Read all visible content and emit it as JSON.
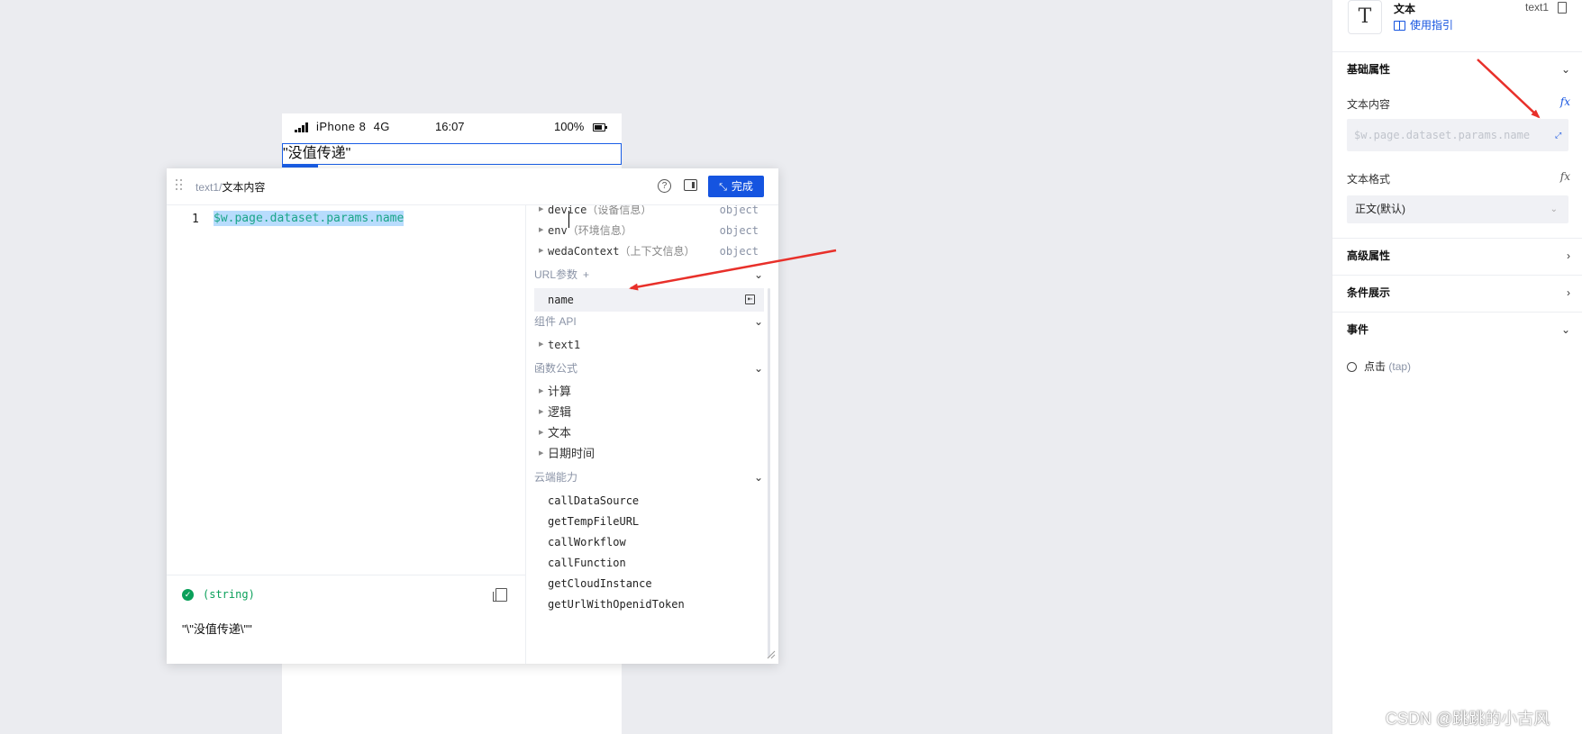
{
  "phone": {
    "device": "iPhone 8",
    "network": "4G",
    "time": "16:07",
    "battery": "100%",
    "text_component_value": "\"没值传递\""
  },
  "editor": {
    "breadcrumb_component": "text1",
    "breadcrumb_sep": "/",
    "breadcrumb_prop": "文本内容",
    "help_icon": "?",
    "done_label": "完成",
    "code_line_number": "1",
    "code": "$w.page.dataset.params.name",
    "result_type": "(string)",
    "result_value": "\"\\\"没值传递\\\"\"",
    "side": {
      "variables": [
        {
          "name": "device",
          "desc": "（设备信息）",
          "type": "object"
        },
        {
          "name": "env",
          "desc": "（环境信息）",
          "type": "object"
        },
        {
          "name": "wedaContext",
          "desc": "（上下文信息）",
          "type": "object"
        }
      ],
      "url_params_title": "URL参数",
      "url_params_add": "+",
      "url_params": [
        "name"
      ],
      "component_api_title": "组件 API",
      "component_api": [
        "text1"
      ],
      "formula_title": "函数公式",
      "formulas": [
        "计算",
        "逻辑",
        "文本",
        "日期时间"
      ],
      "cloud_title": "云端能力",
      "cloud": [
        "callDataSource",
        "getTempFileURL",
        "callWorkflow",
        "callFunction",
        "getCloudInstance",
        "getUrlWithOpenidToken"
      ]
    }
  },
  "props": {
    "component_icon": "T",
    "component_name": "文本",
    "guide_link": "使用指引",
    "component_id": "text1",
    "basic_title": "基础属性",
    "text_content_label": "文本内容",
    "fx": "fx",
    "text_content_value": "$w.page.dataset.params.name",
    "text_format_label": "文本格式",
    "text_format_value": "正文(默认)",
    "advanced_title": "高级属性",
    "condition_title": "条件展示",
    "events_title": "事件",
    "event_tap_label": "点击",
    "event_tap_en": "(tap)"
  },
  "watermark": "CSDN @跳跳的小古风",
  "colors": {
    "accent": "#1554e0",
    "success": "#0aa05a",
    "code_text": "#1aa589",
    "annotation_arrow": "#e8302a"
  }
}
